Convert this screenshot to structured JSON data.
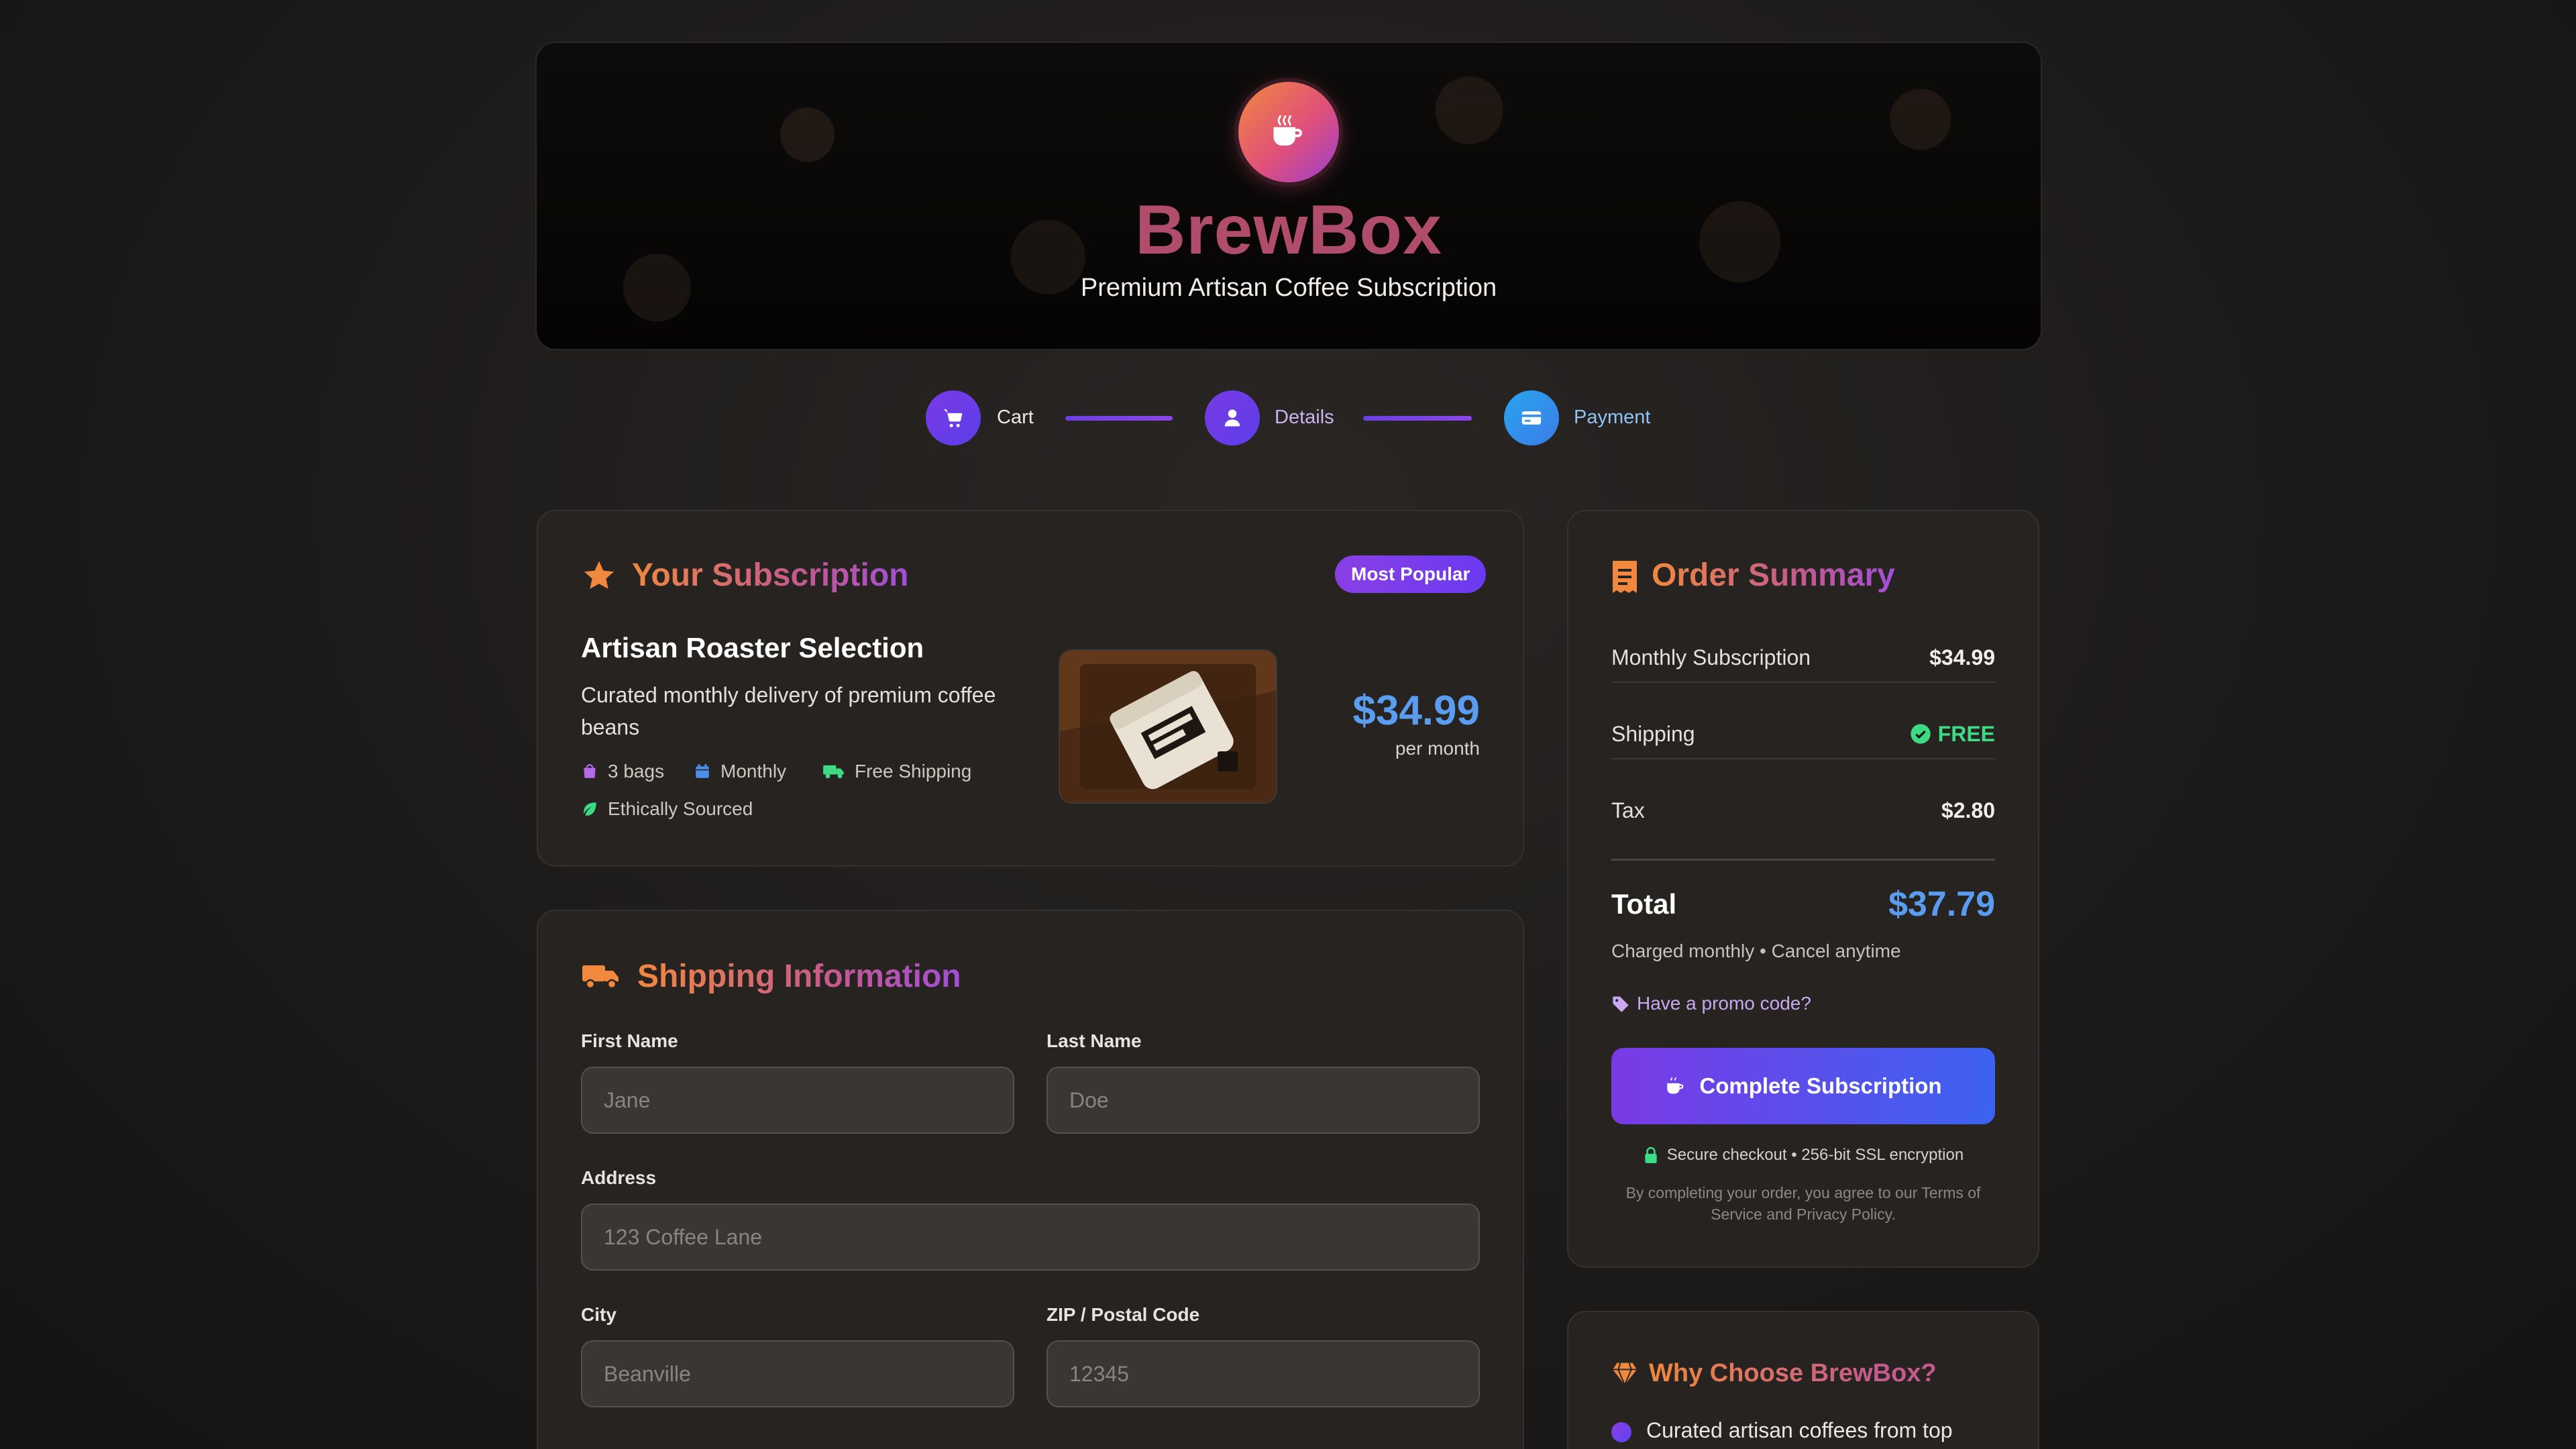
{
  "brand": {
    "name": "BrewBox",
    "tagline": "Premium Artisan Coffee Subscription"
  },
  "steps": [
    {
      "label": "Cart",
      "icon": "cart-icon",
      "color": "#6c3ee6"
    },
    {
      "label": "Details",
      "icon": "user-icon",
      "color": "#6a3fe8"
    },
    {
      "label": "Payment",
      "icon": "credit-card-icon",
      "color": "#2f8fe6"
    }
  ],
  "subscription": {
    "title": "Your Subscription",
    "badge": "Most Popular",
    "product_name": "Artisan Roaster Selection",
    "description": "Curated monthly delivery of premium coffee beans",
    "features": [
      {
        "label": "3 bags",
        "icon": "bag-icon"
      },
      {
        "label": "Monthly",
        "icon": "calendar-icon"
      },
      {
        "label": "Free Shipping",
        "icon": "truck-icon"
      },
      {
        "label": "Ethically Sourced",
        "icon": "leaf-icon"
      }
    ],
    "price": "$34.99",
    "period": "per month"
  },
  "shipping": {
    "title": "Shipping Information",
    "first_name": {
      "label": "First Name",
      "placeholder": "Jane"
    },
    "last_name": {
      "label": "Last Name",
      "placeholder": "Doe"
    },
    "address": {
      "label": "Address",
      "placeholder": "123 Coffee Lane"
    },
    "city": {
      "label": "City",
      "placeholder": "Beanville"
    },
    "zip": {
      "label": "ZIP / Postal Code",
      "placeholder": "12345"
    }
  },
  "summary": {
    "title": "Order Summary",
    "rows": [
      {
        "label": "Monthly Subscription",
        "value": "$34.99"
      },
      {
        "label": "Shipping",
        "value": "FREE"
      },
      {
        "label": "Tax",
        "value": "$2.80"
      }
    ],
    "total_label": "Total",
    "total_value": "$37.79",
    "charged_note": "Charged monthly • Cancel anytime",
    "promo_link": "Have a promo code?",
    "cta_label": "Complete Subscription",
    "secure_note": "Secure checkout • 256-bit SSL encryption",
    "terms": "By completing your order, you agree to our Terms of Service and Privacy Policy."
  },
  "why": {
    "title": "Why Choose BrewBox?",
    "items": [
      "Curated artisan coffees from top"
    ]
  },
  "colors": {
    "accent_blue": "#5a9df0",
    "accent_purple": "#7a3ae6",
    "accent_orange": "#f0883e",
    "free_green": "#3ddc84",
    "background": "#1c1a19"
  }
}
